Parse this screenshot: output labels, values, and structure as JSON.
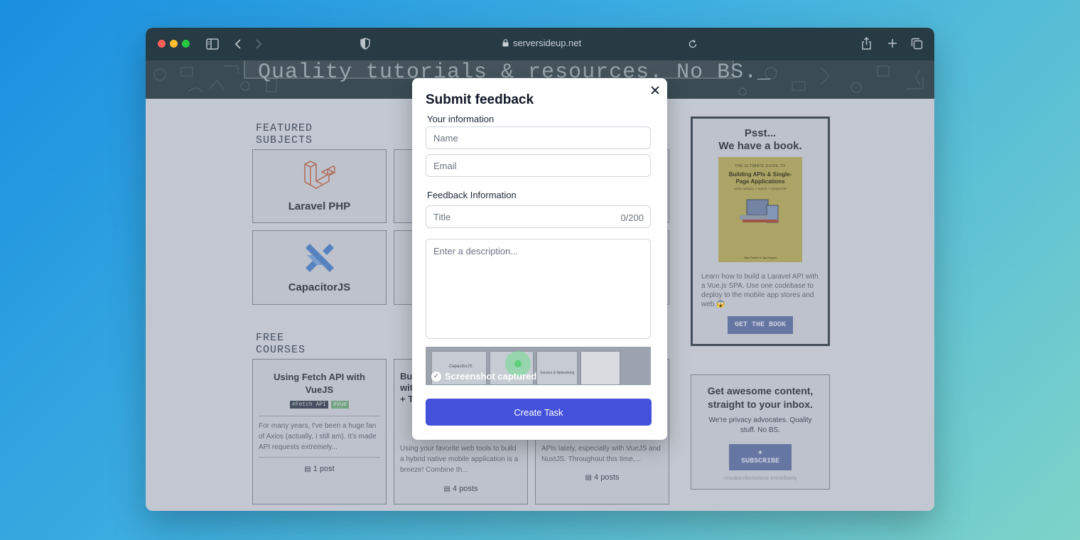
{
  "browser": {
    "url": "serversideup.net",
    "colors": {
      "close": "#ff5f57",
      "minimize": "#febc2e",
      "maximize": "#28c840",
      "toolbar": "#263b44"
    }
  },
  "hero": {
    "tagline": "Quality tutorials & resources. No BS._"
  },
  "featured": {
    "title": "FEATURED SUBJECTS",
    "subjects": [
      {
        "label": "Laravel PHP",
        "icon": "laravel-icon"
      },
      {
        "label": "CapacitorJS",
        "icon": "capacitor-icon"
      }
    ]
  },
  "courses": {
    "title": "FREE COURSES",
    "items": [
      {
        "title": "Using Fetch API with VueJS",
        "tags": [
          "#Fetch API",
          "#Vue"
        ],
        "description": "For many years, I've been a huge fan of Axios (actually, I still am). It's made API requests extremely...",
        "count": "1 post"
      },
      {
        "title_lines": [
          "Bui",
          "wit",
          "+ T"
        ],
        "description": "Using your favorite web tools to build a hybrid native mobile application is a breeze! Combine th...",
        "count": "4 posts"
      },
      {
        "description": "APIs lately, especially with VueJS and NuxtJS. Throughout this time,...",
        "count": "4 posts"
      }
    ]
  },
  "book": {
    "head_line1": "Psst...",
    "head_line2": "We have a book.",
    "cover_small": "THE ULTIMATE GUIDE TO",
    "cover_title": "Building APIs & Single-Page Applications",
    "cover_sub": "WITH LARAVEL + VUEJS + CAPACITOR",
    "cover_authors": "Dan Pastori & Jay Rogers",
    "description": "Learn how to build a Laravel API with a Vue.js SPA. Use one codebase to deploy to the mobile app stores and web.😱",
    "button": "GET THE BOOK"
  },
  "newsletter": {
    "head": "Get awesome content, straight to your inbox.",
    "text": "We're privacy advocates. Quality stuff. No BS.",
    "button": "SUBSCRIBE",
    "note": "Unsubscribe/remove immediately"
  },
  "modal": {
    "title": "Submit feedback",
    "your_info_label": "Your information",
    "name_placeholder": "Name",
    "email_placeholder": "Email",
    "feedback_label": "Feedback Information",
    "title_placeholder": "Title",
    "title_counter": "0/200",
    "description_placeholder": "Enter a description...",
    "screenshot_label": "Screenshot captured",
    "shot_tiles": [
      "CapacitorJS",
      "Servers & Networking"
    ],
    "submit_label": "Create Task",
    "colors": {
      "primary": "#4451db"
    }
  }
}
